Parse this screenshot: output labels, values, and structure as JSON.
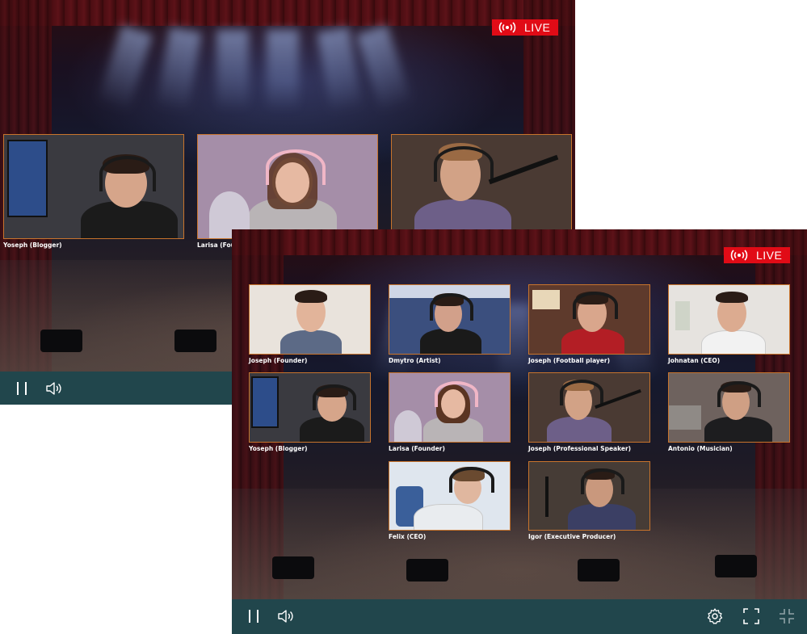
{
  "back_player": {
    "live_label": "LIVE",
    "controls": {
      "pause": "pause-icon",
      "volume": "volume-icon"
    },
    "participants": [
      {
        "name": "Yoseph (Blogger)",
        "bg": "#3a3a40",
        "shirt": "#1b1b1b",
        "skin": "#d6a58a"
      },
      {
        "name": "Larisa (Fou",
        "bg": "#a58ea8",
        "shirt": "#b9b4b6",
        "skin": "#e6b9a2"
      },
      {
        "name": "",
        "bg": "#4a3a33",
        "shirt": "#6d5f88",
        "skin": "#d2a286"
      }
    ]
  },
  "front_player": {
    "live_label": "LIVE",
    "controls": {
      "pause": "pause-icon",
      "volume": "volume-icon",
      "settings": "gear-icon",
      "fullscreen": "fullscreen-icon",
      "exit_fullscreen": "exit-fullscreen-icon"
    },
    "participants": [
      {
        "name": "Joseph (Founder)",
        "bg": "#e9e3dc",
        "shirt": "#5c6a86",
        "skin": "#e2b49a"
      },
      {
        "name": "Dmytro (Artist)",
        "bg": "#3b4f7e",
        "shirt": "#1a1a1a",
        "skin": "#d2a08a"
      },
      {
        "name": "Joseph (Football player)",
        "bg": "#5e3a2c",
        "shirt": "#b31e25",
        "skin": "#d9a68c"
      },
      {
        "name": "Johnatan (CEO)",
        "bg": "#e6e3df",
        "shirt": "#f2f2f2",
        "skin": "#dcab90"
      },
      {
        "name": "Yoseph (Blogger)",
        "bg": "#3a3a40",
        "shirt": "#1b1b1b",
        "skin": "#d6a58a"
      },
      {
        "name": "Larisa (Founder)",
        "bg": "#a58ea8",
        "shirt": "#b9b4b6",
        "skin": "#e6b9a2"
      },
      {
        "name": "Joseph (Professional Speaker)",
        "bg": "#4a3a33",
        "shirt": "#6d5f88",
        "skin": "#d2a286"
      },
      {
        "name": "Antonio (Musician)",
        "bg": "#6e625e",
        "shirt": "#1d1d1f",
        "skin": "#cf9f84"
      },
      {
        "name": "Felix (CEO)",
        "bg": "#dfe6ee",
        "shirt": "#e9ecef",
        "skin": "#e0b79f"
      },
      {
        "name": "Igor (Executive Producer)",
        "bg": "#463c36",
        "shirt": "#3b3f64",
        "skin": "#c9987d"
      }
    ]
  },
  "colors": {
    "live_badge": "#e10b16",
    "control_bar": "#21464c",
    "tile_border": "#c8742c"
  }
}
